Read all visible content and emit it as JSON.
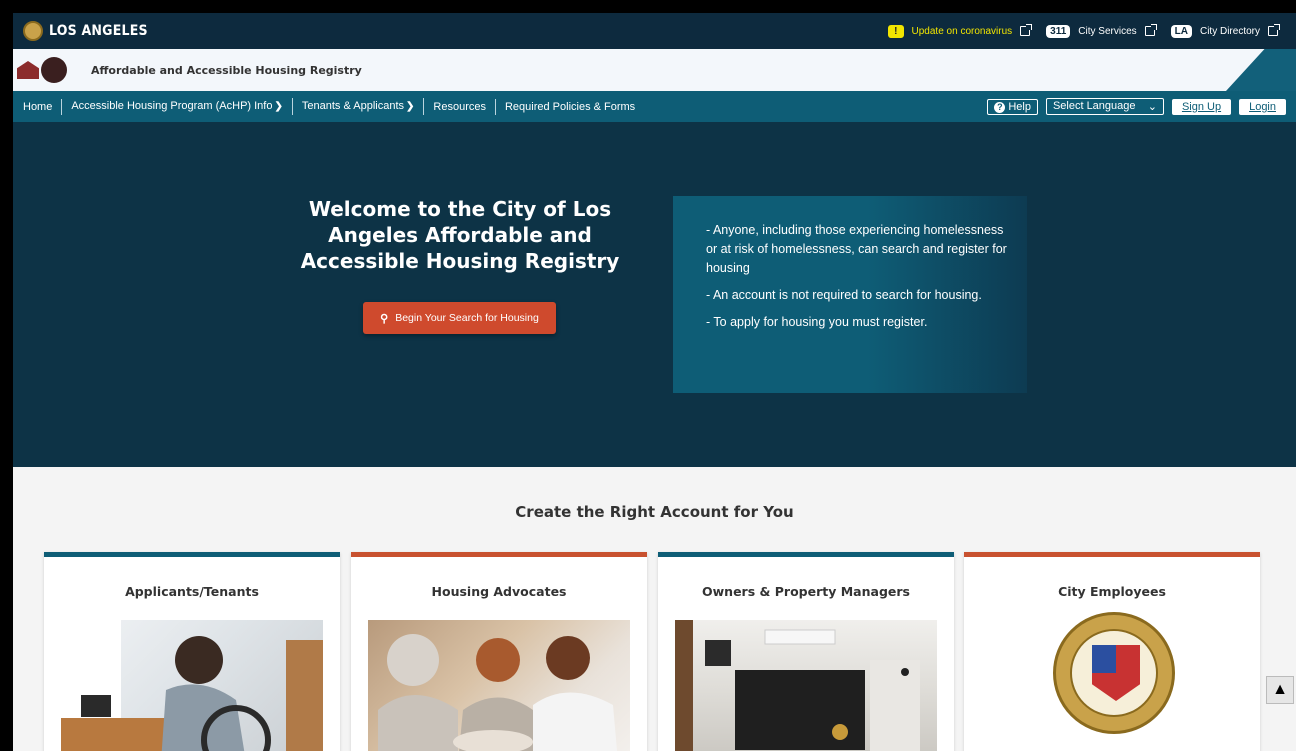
{
  "citybar": {
    "name": "LOS ANGELES",
    "alert_badge": "!",
    "covid_link": "Update on coronavirus",
    "services_badge": "311",
    "services_link": "City Services",
    "directory_badge": "LA",
    "directory_link": "City Directory"
  },
  "header": {
    "title": "Affordable and Accessible Housing Registry"
  },
  "nav": {
    "items": [
      {
        "label": "Home"
      },
      {
        "label": "Accessible Housing Program (AcHP) Info"
      },
      {
        "label": "Tenants & Applicants"
      },
      {
        "label": "Resources"
      },
      {
        "label": "Required Policies & Forms"
      }
    ],
    "help": "Help",
    "language": "Select Language",
    "signup": "Sign Up",
    "login": "Login"
  },
  "hero": {
    "title": "Welcome to the City of Los Angeles Affordable and Accessible Housing Registry",
    "search_button": "Begin Your Search for Housing",
    "info_lines": [
      "- Anyone, including those experiencing homelessness or at risk of homelessness, can search and register for housing",
      "- An account is not required to search for housing.",
      "- To apply for housing you must register."
    ]
  },
  "accounts": {
    "title": "Create the Right Account for You",
    "cards": [
      {
        "title": "Applicants/Tenants",
        "accent": "#0e5d76"
      },
      {
        "title": "Housing Advocates",
        "accent": "#c8512f"
      },
      {
        "title": "Owners & Property Managers",
        "accent": "#0e5d76"
      },
      {
        "title": "City Employees",
        "accent": "#c8512f"
      }
    ]
  },
  "colors": {
    "navy": "#0d2a3e",
    "teal": "#0e5d76",
    "orange": "#cf4a2d",
    "warning": "#f2e500"
  }
}
